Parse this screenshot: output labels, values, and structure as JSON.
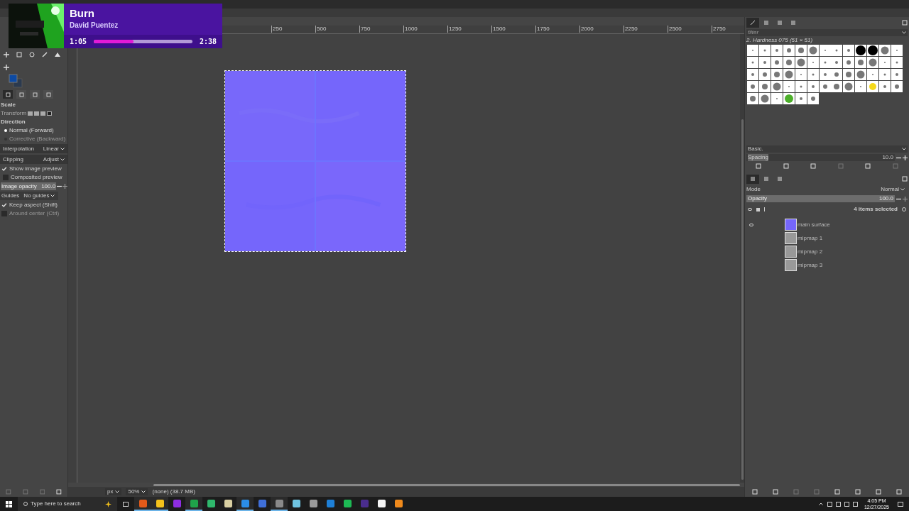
{
  "now_playing": {
    "title": "Burn",
    "artist": "David Puentez",
    "elapsed": "1:05",
    "total": "2:38",
    "level": 0.4
  },
  "tool_options": {
    "tabs": [
      {
        "selected": true
      },
      {
        "selected": false
      },
      {
        "selected": false
      },
      {
        "selected": false
      }
    ],
    "title": "Scale",
    "transform_label": "Transform",
    "direction_label": "Direction",
    "directions": [
      {
        "label": "Normal (Forward)",
        "selected": true
      },
      {
        "label": "Corrective (Backward)",
        "selected": false
      }
    ],
    "interpolation": {
      "label": "Interpolation",
      "value": "Linear"
    },
    "clipping": {
      "label": "Clipping",
      "value": "Adjust"
    },
    "show_preview": {
      "label": "Show image preview",
      "checked": true
    },
    "composited": {
      "label": "Composited preview",
      "checked": false
    },
    "opacity": {
      "label": "Image opacity",
      "value": "100.0"
    },
    "guides": {
      "label": "Guides",
      "value": "No guides"
    },
    "keep_aspect": {
      "label": "Keep aspect (Shift)",
      "checked": true
    },
    "around_center": {
      "label": "Around center (Ctrl)",
      "checked": false
    }
  },
  "ruler_labels": [
    "250",
    "500",
    "750",
    "1000",
    "1250",
    "1500",
    "1750",
    "2000",
    "2250",
    "2500",
    "2750"
  ],
  "brushes": {
    "filter_placeholder": "filter",
    "brush_name": "2. Hardness 075 (51 × 51)",
    "preset": "Basic.",
    "spacing_label": "Spacing",
    "spacing_value": "10.0"
  },
  "layers": {
    "mode_label": "Mode",
    "mode_value": "Normal",
    "opacity_label": "Opacity",
    "opacity_value": "100.0",
    "selection": "4 items selected",
    "items": [
      {
        "name": "main surface",
        "visible": true
      },
      {
        "name": "mipmap 1",
        "visible": false
      },
      {
        "name": "mipmap 2",
        "visible": false
      },
      {
        "name": "mipmap 3",
        "visible": false
      }
    ]
  },
  "status_bar": {
    "unit": "px",
    "zoom": "50%",
    "info": "(none) (38.7 MB)"
  },
  "taskbar": {
    "search_placeholder": "Type here to search",
    "time": "4:05 PM",
    "date": "12/27/2025",
    "apps": [
      {
        "color": "#e35a1a",
        "active": true
      },
      {
        "color": "#f4c21b",
        "active": true
      },
      {
        "color": "#8e2de2",
        "active": false
      },
      {
        "color": "#1fa34a",
        "active": true
      },
      {
        "color": "#2fb86c",
        "active": false
      },
      {
        "color": "#d9cfa2",
        "active": false
      },
      {
        "color": "#2b8ee8",
        "active": true
      },
      {
        "color": "#3f6fd8",
        "active": false
      },
      {
        "color": "#8a8a8a",
        "active": true
      },
      {
        "color": "#6fc3e0",
        "active": false
      },
      {
        "color": "#9a9a9a",
        "active": false
      },
      {
        "color": "#1e7fd6",
        "active": false
      },
      {
        "color": "#1db954",
        "active": false
      },
      {
        "color": "#4a2d8e",
        "active": false
      },
      {
        "color": "#f5f5f5",
        "active": false
      },
      {
        "color": "#f08a1c",
        "active": false
      }
    ]
  }
}
